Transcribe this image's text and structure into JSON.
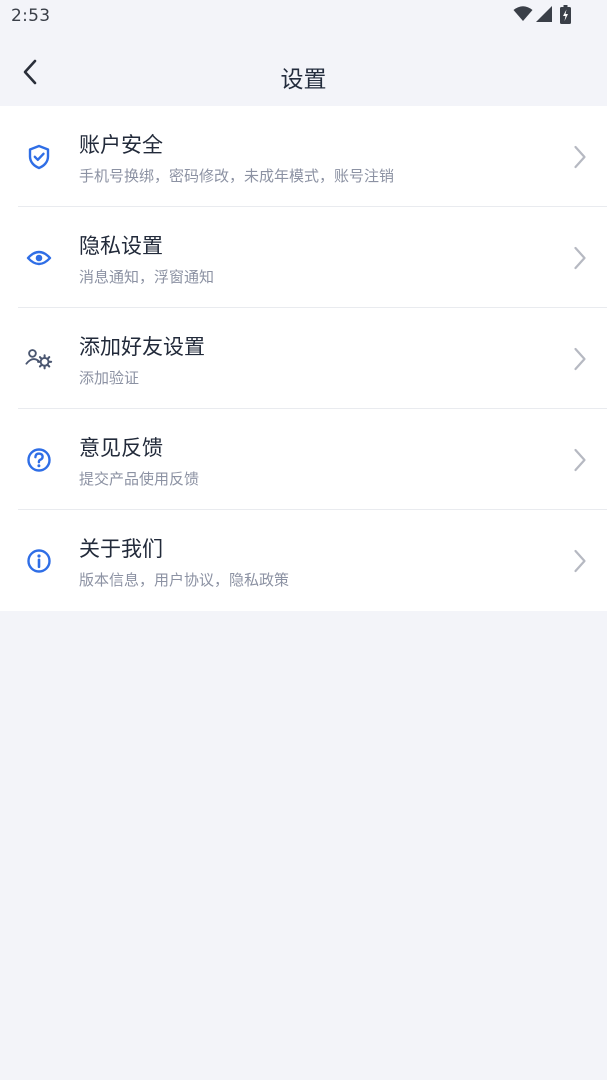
{
  "status_bar": {
    "time": "2:53",
    "icons": [
      "wifi-icon",
      "cellular-signal-icon",
      "battery-charging-icon"
    ]
  },
  "header": {
    "title": "设置",
    "back_icon": "chevron-left-icon"
  },
  "menu": {
    "items": [
      {
        "title": "账户安全",
        "subtitle": "手机号换绑，密码修改，未成年模式，账号注销",
        "icon": "shield-check-icon"
      },
      {
        "title": "隐私设置",
        "subtitle": "消息通知，浮窗通知",
        "icon": "eye-icon"
      },
      {
        "title": "添加好友设置",
        "subtitle": "添加验证",
        "icon": "user-gear-icon"
      },
      {
        "title": "意见反馈",
        "subtitle": "提交产品使用反馈",
        "icon": "question-circle-icon"
      },
      {
        "title": "关于我们",
        "subtitle": "版本信息，用户协议，隐私政策",
        "icon": "info-circle-icon"
      }
    ]
  },
  "colors": {
    "accent": "#2f6ee6",
    "background": "#f3f4f9",
    "card": "#ffffff",
    "title_text": "#222a3a",
    "subtitle_text": "#8c92a3",
    "chevron": "#b6b9c2"
  }
}
